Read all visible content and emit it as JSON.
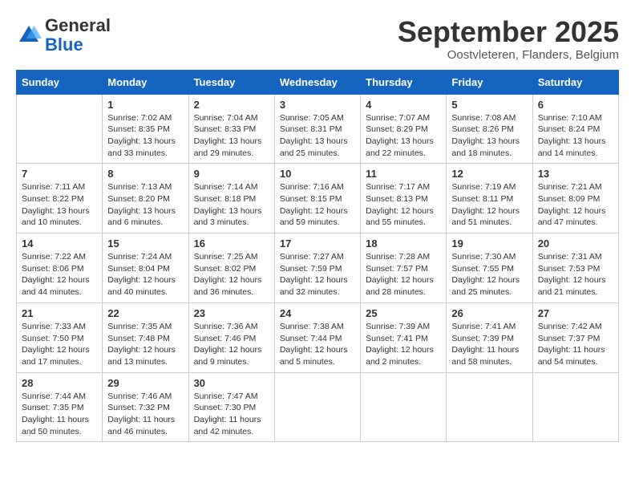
{
  "header": {
    "logo_general": "General",
    "logo_blue": "Blue",
    "month_title": "September 2025",
    "subtitle": "Oostvleteren, Flanders, Belgium"
  },
  "days_of_week": [
    "Sunday",
    "Monday",
    "Tuesday",
    "Wednesday",
    "Thursday",
    "Friday",
    "Saturday"
  ],
  "weeks": [
    [
      {
        "day": "",
        "info": ""
      },
      {
        "day": "1",
        "info": "Sunrise: 7:02 AM\nSunset: 8:35 PM\nDaylight: 13 hours\nand 33 minutes."
      },
      {
        "day": "2",
        "info": "Sunrise: 7:04 AM\nSunset: 8:33 PM\nDaylight: 13 hours\nand 29 minutes."
      },
      {
        "day": "3",
        "info": "Sunrise: 7:05 AM\nSunset: 8:31 PM\nDaylight: 13 hours\nand 25 minutes."
      },
      {
        "day": "4",
        "info": "Sunrise: 7:07 AM\nSunset: 8:29 PM\nDaylight: 13 hours\nand 22 minutes."
      },
      {
        "day": "5",
        "info": "Sunrise: 7:08 AM\nSunset: 8:26 PM\nDaylight: 13 hours\nand 18 minutes."
      },
      {
        "day": "6",
        "info": "Sunrise: 7:10 AM\nSunset: 8:24 PM\nDaylight: 13 hours\nand 14 minutes."
      }
    ],
    [
      {
        "day": "7",
        "info": "Sunrise: 7:11 AM\nSunset: 8:22 PM\nDaylight: 13 hours\nand 10 minutes."
      },
      {
        "day": "8",
        "info": "Sunrise: 7:13 AM\nSunset: 8:20 PM\nDaylight: 13 hours\nand 6 minutes."
      },
      {
        "day": "9",
        "info": "Sunrise: 7:14 AM\nSunset: 8:18 PM\nDaylight: 13 hours\nand 3 minutes."
      },
      {
        "day": "10",
        "info": "Sunrise: 7:16 AM\nSunset: 8:15 PM\nDaylight: 12 hours\nand 59 minutes."
      },
      {
        "day": "11",
        "info": "Sunrise: 7:17 AM\nSunset: 8:13 PM\nDaylight: 12 hours\nand 55 minutes."
      },
      {
        "day": "12",
        "info": "Sunrise: 7:19 AM\nSunset: 8:11 PM\nDaylight: 12 hours\nand 51 minutes."
      },
      {
        "day": "13",
        "info": "Sunrise: 7:21 AM\nSunset: 8:09 PM\nDaylight: 12 hours\nand 47 minutes."
      }
    ],
    [
      {
        "day": "14",
        "info": "Sunrise: 7:22 AM\nSunset: 8:06 PM\nDaylight: 12 hours\nand 44 minutes."
      },
      {
        "day": "15",
        "info": "Sunrise: 7:24 AM\nSunset: 8:04 PM\nDaylight: 12 hours\nand 40 minutes."
      },
      {
        "day": "16",
        "info": "Sunrise: 7:25 AM\nSunset: 8:02 PM\nDaylight: 12 hours\nand 36 minutes."
      },
      {
        "day": "17",
        "info": "Sunrise: 7:27 AM\nSunset: 7:59 PM\nDaylight: 12 hours\nand 32 minutes."
      },
      {
        "day": "18",
        "info": "Sunrise: 7:28 AM\nSunset: 7:57 PM\nDaylight: 12 hours\nand 28 minutes."
      },
      {
        "day": "19",
        "info": "Sunrise: 7:30 AM\nSunset: 7:55 PM\nDaylight: 12 hours\nand 25 minutes."
      },
      {
        "day": "20",
        "info": "Sunrise: 7:31 AM\nSunset: 7:53 PM\nDaylight: 12 hours\nand 21 minutes."
      }
    ],
    [
      {
        "day": "21",
        "info": "Sunrise: 7:33 AM\nSunset: 7:50 PM\nDaylight: 12 hours\nand 17 minutes."
      },
      {
        "day": "22",
        "info": "Sunrise: 7:35 AM\nSunset: 7:48 PM\nDaylight: 12 hours\nand 13 minutes."
      },
      {
        "day": "23",
        "info": "Sunrise: 7:36 AM\nSunset: 7:46 PM\nDaylight: 12 hours\nand 9 minutes."
      },
      {
        "day": "24",
        "info": "Sunrise: 7:38 AM\nSunset: 7:44 PM\nDaylight: 12 hours\nand 5 minutes."
      },
      {
        "day": "25",
        "info": "Sunrise: 7:39 AM\nSunset: 7:41 PM\nDaylight: 12 hours\nand 2 minutes."
      },
      {
        "day": "26",
        "info": "Sunrise: 7:41 AM\nSunset: 7:39 PM\nDaylight: 11 hours\nand 58 minutes."
      },
      {
        "day": "27",
        "info": "Sunrise: 7:42 AM\nSunset: 7:37 PM\nDaylight: 11 hours\nand 54 minutes."
      }
    ],
    [
      {
        "day": "28",
        "info": "Sunrise: 7:44 AM\nSunset: 7:35 PM\nDaylight: 11 hours\nand 50 minutes."
      },
      {
        "day": "29",
        "info": "Sunrise: 7:46 AM\nSunset: 7:32 PM\nDaylight: 11 hours\nand 46 minutes."
      },
      {
        "day": "30",
        "info": "Sunrise: 7:47 AM\nSunset: 7:30 PM\nDaylight: 11 hours\nand 42 minutes."
      },
      {
        "day": "",
        "info": ""
      },
      {
        "day": "",
        "info": ""
      },
      {
        "day": "",
        "info": ""
      },
      {
        "day": "",
        "info": ""
      }
    ]
  ]
}
